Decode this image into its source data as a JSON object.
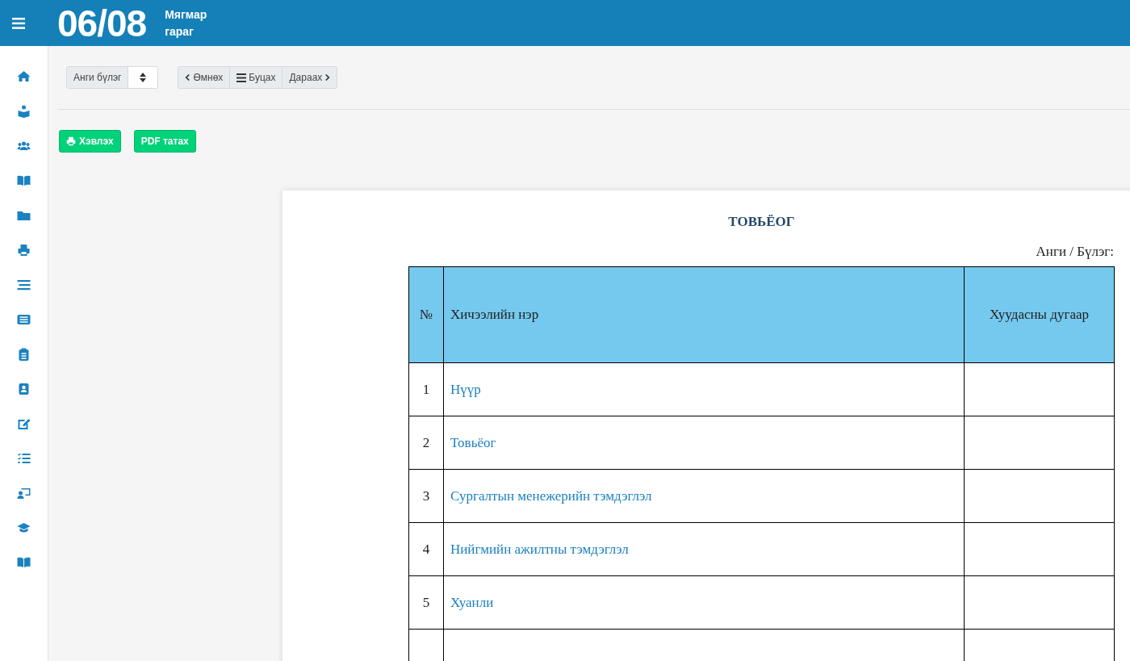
{
  "header": {
    "date": "06/08",
    "weekday_line_1": "Мягмар",
    "weekday_line_2": "гараг"
  },
  "toolbar": {
    "class_select": {
      "label": "Анги бүлэг"
    },
    "nav_buttons": [
      {
        "kind": "prev",
        "label": "Өмнөх"
      },
      {
        "kind": "list",
        "label": "Буцах"
      },
      {
        "kind": "next",
        "label": "Дараах"
      }
    ]
  },
  "actions": [
    {
      "kind": "print",
      "label": "Хэвлэх"
    },
    {
      "kind": "pdf",
      "label": "PDF татах"
    }
  ],
  "document": {
    "title": "ТОВЬЁОГ",
    "class_line": "Анги / Бүлэг:",
    "table": {
      "columns": [
        "№",
        "Хичээлийн нэр",
        "Хуудасны дугаар"
      ],
      "rows": [
        {
          "number": "1",
          "name": "Нүүр"
        },
        {
          "number": "2",
          "name": "Товьёог"
        },
        {
          "number": "3",
          "name": "Сургалтын менежерийн тэмдэглэл"
        },
        {
          "number": "4",
          "name": "Нийгмийн ажилтны тэмдэглэл"
        },
        {
          "number": "5",
          "name": "Хуанли"
        }
      ]
    }
  }
}
